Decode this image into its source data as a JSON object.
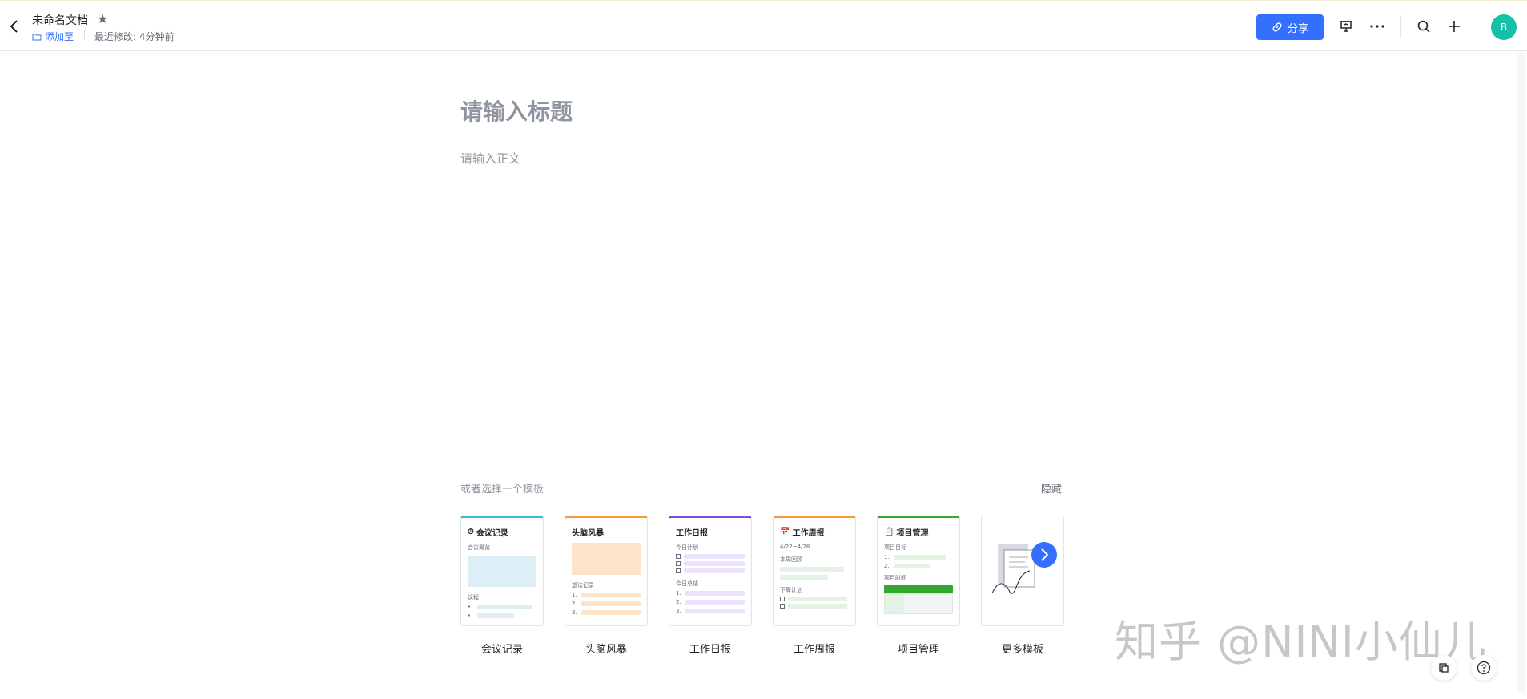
{
  "header": {
    "doc_title": "未命名文档",
    "add_to": "添加至",
    "last_modified": "最近修改: 4分钟前",
    "share_label": "分享",
    "avatar_letter": "B"
  },
  "editor": {
    "title_placeholder": "请输入标题",
    "body_placeholder": "请输入正文"
  },
  "templates": {
    "heading": "或者选择一个模板",
    "hide_label": "隐藏",
    "items": [
      {
        "label": "会议记录",
        "card_title": "会议记录",
        "card_icon": "stopwatch-icon",
        "accent": "#3bb6d9",
        "sub1": "会议概览",
        "sub2": "议程"
      },
      {
        "label": "头脑风暴",
        "card_title": "头脑风暴",
        "accent": "#f29a3a",
        "sub1": "想法记录",
        "nums": [
          "1.",
          "2.",
          "3."
        ]
      },
      {
        "label": "工作日报",
        "card_title": "工作日报",
        "accent": "#7a4fd6",
        "sub1": "今日计划",
        "sub2": "今日总结",
        "nums": [
          "1.",
          "2.",
          "3."
        ]
      },
      {
        "label": "工作周报",
        "card_title": "工作周报",
        "card_icon": "calendar-icon",
        "accent": "#f29a3a",
        "sub1": "4/22~4/28",
        "sub2": "本周回顾",
        "sub3": "下周计划"
      },
      {
        "label": "项目管理",
        "card_title": "项目管理",
        "card_icon": "clipboard-icon",
        "accent": "#34a82e",
        "sub1": "项目目标",
        "sub2": "项目时间",
        "nums": [
          "1.",
          "2."
        ]
      },
      {
        "label": "更多模板"
      }
    ]
  },
  "watermark": "知乎 @NINI小仙儿",
  "colors": {
    "accent": "#3370ff",
    "avatar": "#14c0a8"
  }
}
